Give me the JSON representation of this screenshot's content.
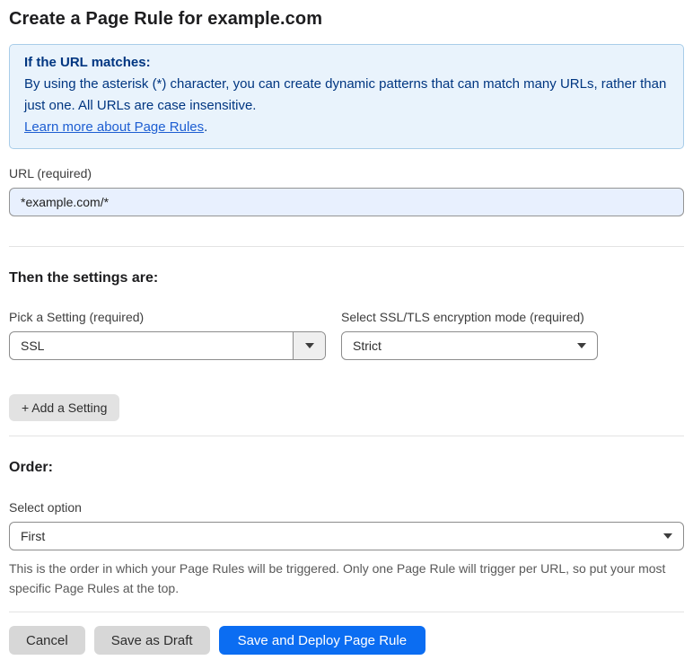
{
  "page": {
    "title": "Create a Page Rule for example.com"
  },
  "info_box": {
    "heading": "If the URL matches:",
    "body": "By using the asterisk (*) character, you can create dynamic patterns that can match many URLs, rather than just one. All URLs are case insensitive.",
    "link_text": "Learn more about Page Rules",
    "link_suffix": "."
  },
  "url_field": {
    "label": "URL (required)",
    "value": "*example.com/*"
  },
  "settings_section": {
    "heading": "Then the settings are:",
    "setting_picker": {
      "label": "Pick a Setting (required)",
      "value": "SSL"
    },
    "ssl_mode_picker": {
      "label": "Select SSL/TLS encryption mode (required)",
      "value": "Strict"
    },
    "add_setting_label": "+ Add a Setting"
  },
  "order_section": {
    "heading": "Order:",
    "select_label": "Select option",
    "value": "First",
    "help_text": "This is the order in which your Page Rules will be triggered. Only one Page Rule will trigger per URL, so put your most specific Page Rules at the top."
  },
  "footer": {
    "cancel_label": "Cancel",
    "save_draft_label": "Save as Draft",
    "save_deploy_label": "Save and Deploy Page Rule"
  },
  "icons": {
    "select_caret": "chevron-down"
  },
  "colors": {
    "info_box_background": "#e9f3fc",
    "info_box_border": "#a9cde9",
    "info_box_text": "#003681",
    "link_blue": "#1d5ed2",
    "url_input_background": "#e8f0fe",
    "primary_button_blue": "#0b6df2",
    "gray_button": "#d7d7d7",
    "divider": "#e3e3e3"
  }
}
